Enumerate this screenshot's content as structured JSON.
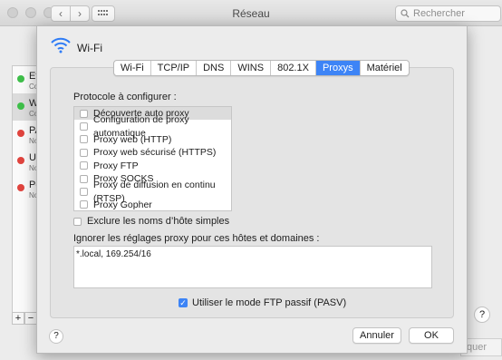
{
  "window": {
    "title": "Réseau",
    "search_placeholder": "Rechercher",
    "nav_back": "‹",
    "nav_forward": "›"
  },
  "background_list": [
    {
      "name": "Et",
      "sub": "Co",
      "status_color": "#3fbf4a"
    },
    {
      "name": "W",
      "sub": "Co",
      "status_color": "#3fbf4a"
    },
    {
      "name": "PA",
      "sub": "No",
      "status_color": "#e0443e"
    },
    {
      "name": "US",
      "sub": "No",
      "status_color": "#e0443e"
    },
    {
      "name": "Po",
      "sub": "No",
      "status_color": "#e0443e"
    }
  ],
  "background_controls": {
    "add": "+",
    "remove": "−",
    "help": "?",
    "apply_partial": "quer"
  },
  "sheet": {
    "title": "Wi-Fi",
    "tabs": [
      "Wi-Fi",
      "TCP/IP",
      "DNS",
      "WINS",
      "802.1X",
      "Proxys",
      "Matériel"
    ],
    "active_tab": "Proxys",
    "protocol_label": "Protocole à configurer :",
    "protocols": [
      {
        "label": "Découverte auto proxy",
        "checked": false,
        "selected": true
      },
      {
        "label": "Configuration de proxy automatique",
        "checked": false
      },
      {
        "label": "Proxy web (HTTP)",
        "checked": false
      },
      {
        "label": "Proxy web sécurisé (HTTPS)",
        "checked": false
      },
      {
        "label": "Proxy FTP",
        "checked": false
      },
      {
        "label": "Proxy SOCKS",
        "checked": false
      },
      {
        "label": "Proxy de diffusion en continu (RTSP)",
        "checked": false
      },
      {
        "label": "Proxy Gopher",
        "checked": false
      }
    ],
    "exclude_simple": {
      "label": "Exclure les noms d’hôte simples",
      "checked": false
    },
    "ignore_label": "Ignorer les réglages proxy pour ces hôtes et domaines :",
    "ignore_value": "*.local, 169.254/16",
    "passive_ftp": {
      "label": "Utiliser le mode FTP passif (PASV)",
      "checked": true
    },
    "help": "?",
    "cancel": "Annuler",
    "ok": "OK"
  },
  "colors": {
    "accent": "#3d84f6",
    "wifi_icon": "#2f7cf6"
  }
}
